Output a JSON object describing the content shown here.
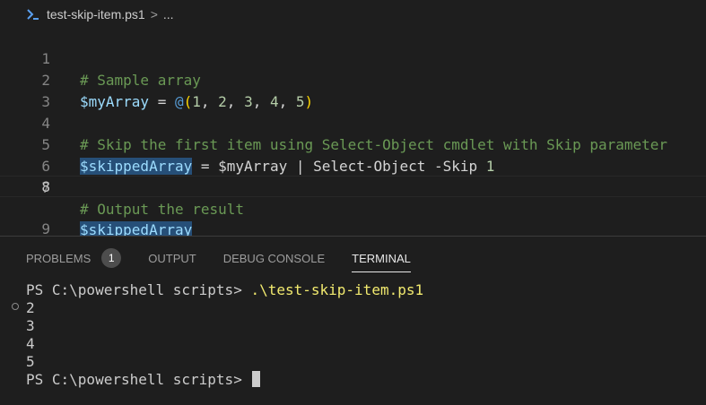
{
  "breadcrumb": {
    "file": "test-skip-item.ps1",
    "separator": ">",
    "ellipsis": "..."
  },
  "editor": {
    "lines": [
      {
        "n": "1",
        "comment": "# Sample array"
      },
      {
        "n": "2",
        "var": "$myArray",
        "eq": " = ",
        "at": "@",
        "open": "(",
        "items": [
          "1",
          ", ",
          "2",
          ", ",
          "3",
          ", ",
          "4",
          ", ",
          "5"
        ],
        "close": ")"
      },
      {
        "n": "3"
      },
      {
        "n": "4",
        "comment": "# Skip the first item using Select-Object cmdlet with Skip parameter"
      },
      {
        "n": "5",
        "var": "$skippedArray",
        "eq": " = ",
        "var2": "$myArray",
        "pipe": " | ",
        "cmd": "Select-Object",
        "param": " -Skip ",
        "num": "1"
      },
      {
        "n": "6"
      },
      {
        "n": "7",
        "comment": "# Output the result"
      },
      {
        "n": "8",
        "var": "$skippedArray"
      },
      {
        "n": "9"
      }
    ]
  },
  "panel": {
    "tabs": [
      {
        "label": "PROBLEMS",
        "badge": "1"
      },
      {
        "label": "OUTPUT"
      },
      {
        "label": "DEBUG CONSOLE"
      },
      {
        "label": "TERMINAL"
      }
    ],
    "terminal": {
      "prompt1": "PS C:\\powershell scripts> ",
      "command": ".\\test-skip-item.ps1",
      "output": [
        "2",
        "3",
        "4",
        "5"
      ],
      "prompt2": "PS C:\\powershell scripts> "
    }
  }
}
